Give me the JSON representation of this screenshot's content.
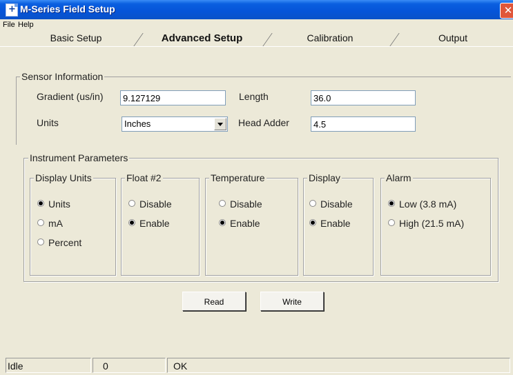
{
  "window": {
    "title": "M-Series Field Setup",
    "close_glyph": "✕"
  },
  "menu": [
    "File",
    "Help"
  ],
  "tabs": [
    {
      "label": "Basic Setup",
      "active": false
    },
    {
      "label": "Advanced Setup",
      "active": true
    },
    {
      "label": "Calibration",
      "active": false
    },
    {
      "label": "Output",
      "active": false
    }
  ],
  "sensor": {
    "legend": "Sensor Information",
    "gradient_label": "Gradient (us/in)",
    "gradient_value": "9.127129",
    "length_label": "Length",
    "length_value": "36.0",
    "units_label": "Units",
    "units_value": "Inches",
    "head_adder_label": "Head Adder",
    "head_adder_value": "4.5"
  },
  "instrument": {
    "legend": "Instrument Parameters",
    "display_units": {
      "legend": "Display Units",
      "options": [
        {
          "label": "Units",
          "selected": true
        },
        {
          "label": "mA",
          "selected": false
        },
        {
          "label": "Percent",
          "selected": false
        }
      ]
    },
    "float2": {
      "legend": "Float #2",
      "options": [
        {
          "label": "Disable",
          "selected": false
        },
        {
          "label": "Enable",
          "selected": true
        }
      ]
    },
    "temperature": {
      "legend": "Temperature",
      "options": [
        {
          "label": "Disable",
          "selected": false
        },
        {
          "label": "Enable",
          "selected": true
        }
      ]
    },
    "display": {
      "legend": "Display",
      "options": [
        {
          "label": "Disable",
          "selected": false
        },
        {
          "label": "Enable",
          "selected": true
        }
      ]
    },
    "alarm": {
      "legend": "Alarm",
      "options": [
        {
          "label": "Low (3.8 mA)",
          "selected": true
        },
        {
          "label": "High (21.5 mA)",
          "selected": false
        }
      ]
    }
  },
  "buttons": {
    "read": "Read",
    "write": "Write"
  },
  "status": [
    "Idle",
    "0",
    "OK"
  ],
  "colors": {
    "titlebar": "#0654d8",
    "close": "#e0563a",
    "face": "#ece9d8"
  },
  "icons": {
    "app": "app-document-icon",
    "close": "close-icon",
    "dropdown": "chevron-down-icon"
  }
}
